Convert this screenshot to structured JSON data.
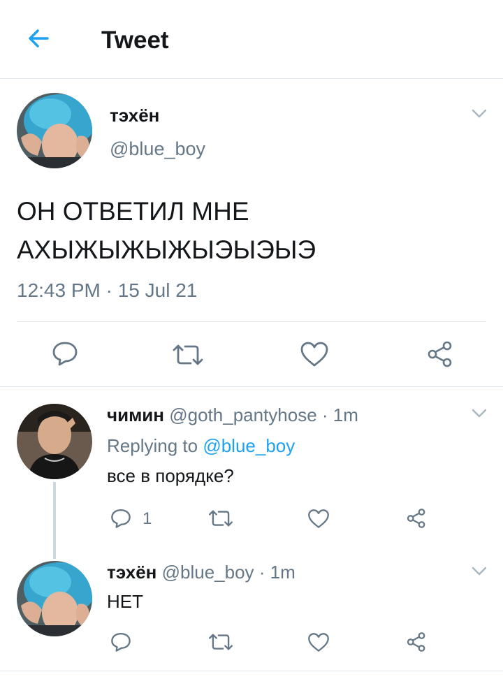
{
  "header": {
    "title": "Tweet",
    "back_icon": "back-arrow-icon",
    "accent": "#1da1f2"
  },
  "main_tweet": {
    "display_name": "тэхён",
    "handle": "@blue_boy",
    "text_line1": "ОН ОТВЕТИЛ МНЕ",
    "text_line2": "АХЫЖЫЖЫЖЫЭЫЭЫЭ",
    "timestamp": "12:43 PM · 15 Jul 21",
    "actions": [
      "reply-icon",
      "retweet-icon",
      "like-icon",
      "share-icon"
    ]
  },
  "replies": [
    {
      "display_name": "чимин",
      "handle": "@goth_pantyhose",
      "time": "· 1m",
      "replying_prefix": "Replying to",
      "replying_handle": "@blue_boy",
      "text": "все в порядке?",
      "reply_count": "1"
    },
    {
      "display_name": "тэхён",
      "handle": "@blue_boy",
      "time": "· 1m",
      "text": "НЕТ"
    }
  ]
}
